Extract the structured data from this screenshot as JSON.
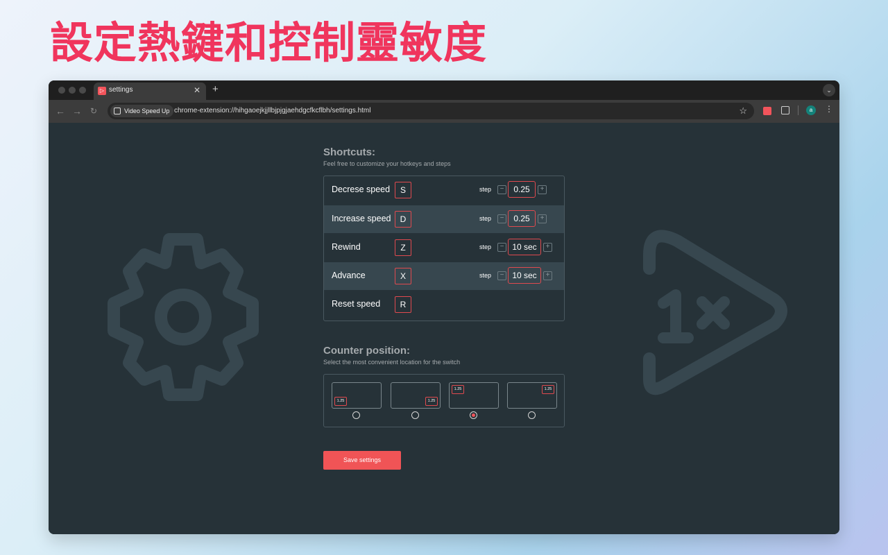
{
  "headline": "設定熱鍵和控制靈敏度",
  "browser": {
    "tab_title": "settings",
    "tab_close": "✕",
    "new_tab": "+",
    "extension_chip": "Video Speed Up",
    "url": "chrome-extension://hihgaoejkjjllbjpjgjaehdgcfkcflbh/settings.html",
    "avatar_letter": "a"
  },
  "shortcuts": {
    "title": "Shortcuts:",
    "subtitle": "Feel free to customize your hotkeys and steps",
    "step_label": "step",
    "rows": [
      {
        "label": "Decrese speed",
        "key": "S",
        "step": "0.25"
      },
      {
        "label": "Increase speed",
        "key": "D",
        "step": "0.25"
      },
      {
        "label": "Rewind",
        "key": "Z",
        "step": "10 sec"
      },
      {
        "label": "Advance",
        "key": "X",
        "step": "10 sec"
      },
      {
        "label": "Reset speed",
        "key": "R"
      }
    ]
  },
  "counter": {
    "title": "Counter position:",
    "subtitle": "Select the most convenient location for the switch",
    "badge": "1.25",
    "options": [
      "bottom-left",
      "bottom-right",
      "top-left",
      "top-right"
    ],
    "selected": "top-left"
  },
  "save_label": "Save settings",
  "colors": {
    "accent": "#f05456",
    "headline": "#f0355d",
    "panel": "#263238",
    "row_alt": "#37474f"
  }
}
